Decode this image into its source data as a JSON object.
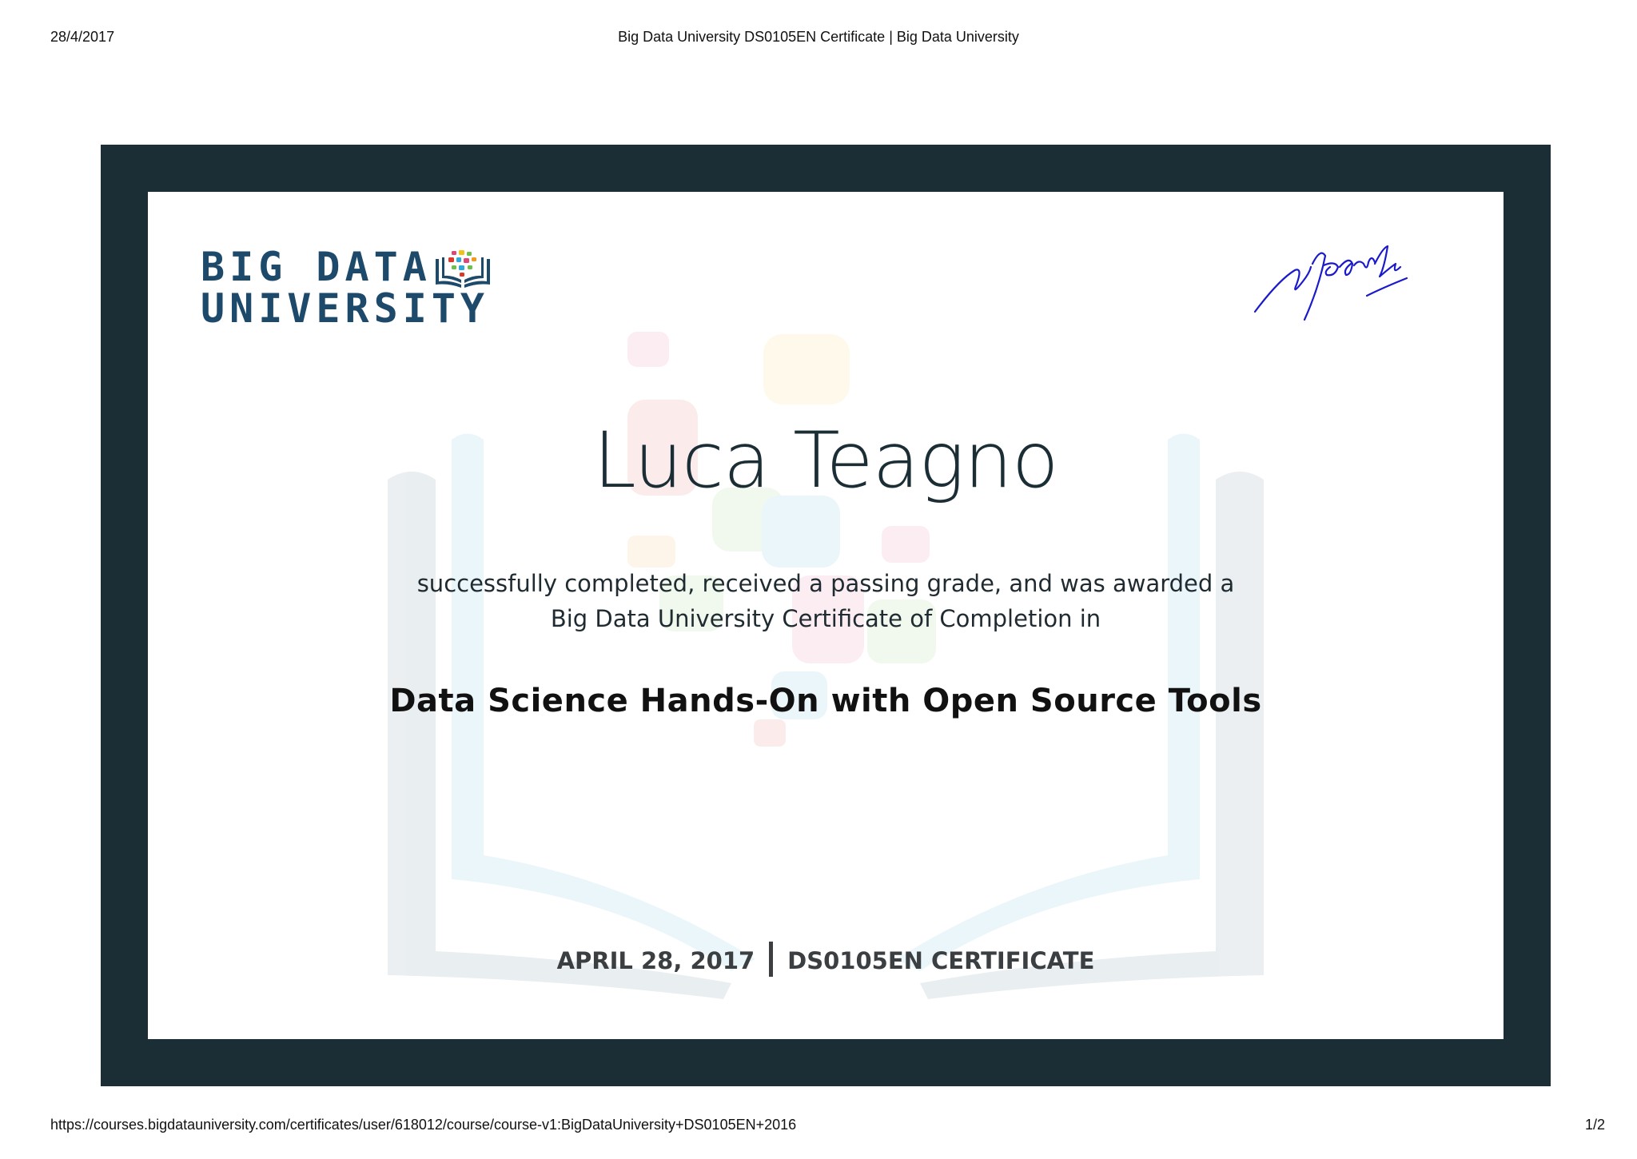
{
  "print_header": {
    "date": "28/4/2017",
    "title": "Big Data University DS0105EN Certificate | Big Data University"
  },
  "print_footer": {
    "url": "https://courses.bigdatauniversity.com/certificates/user/618012/course/course-v1:BigDataUniversity+DS0105EN+2016",
    "page": "1/2"
  },
  "certificate": {
    "logo": {
      "line1": "BIG DATA",
      "line2": "UNIVERSITY"
    },
    "recipient_name": "Luca Teagno",
    "award_text": "successfully completed, received a passing grade, and was awarded a Big Data University Certificate of Completion in",
    "course_title": "Data Science Hands-On with Open Source Tools",
    "date": "APRIL 28, 2017",
    "certificate_type": "DS0105EN CERTIFICATE"
  },
  "colors": {
    "frame": "#1b2e35",
    "logo": "#1d4a6b",
    "signature": "#1a1acc"
  }
}
